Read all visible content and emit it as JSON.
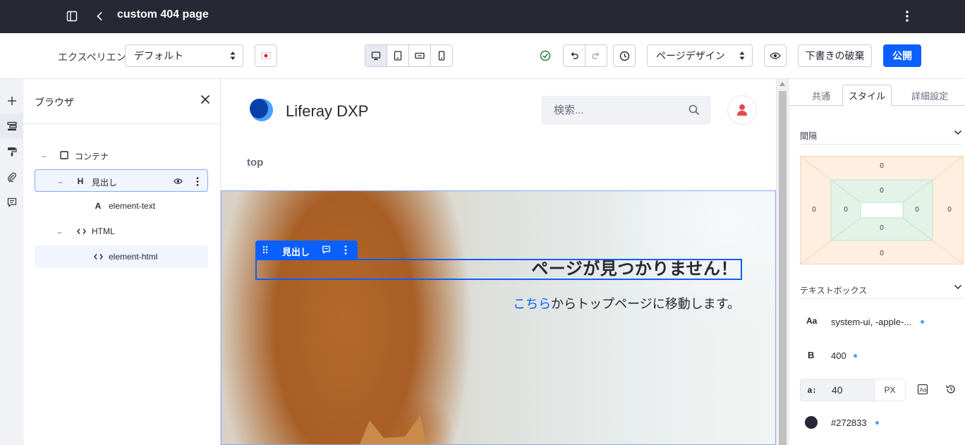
{
  "topbar": {
    "title": "custom 404 page"
  },
  "toolbar": {
    "experience_label": "エクスペリエンス",
    "experience_value": "デフォルト",
    "mode_value": "ページデザイン",
    "discard_label": "下書きの破棄",
    "publish_label": "公開"
  },
  "browser": {
    "title": "ブラウザ",
    "tree": [
      {
        "label": "コンテナ",
        "icon": "H"
      },
      {
        "label": "見出し",
        "icon": "H"
      },
      {
        "label": "element-text",
        "icon": "A"
      },
      {
        "label": "HTML"
      },
      {
        "label": "element-html"
      }
    ]
  },
  "site": {
    "name": "Liferay DXP",
    "search_placeholder": "検索...",
    "nav": "top"
  },
  "fragment": {
    "toolbar_label": "見出し",
    "heading": "ページが見つかりません！",
    "sub_link": "こちら",
    "sub_rest": "からトップページに移動します。"
  },
  "panel": {
    "tabs": [
      "共通",
      "スタイル",
      "詳細設定"
    ],
    "spacing_title": "間隔",
    "spacing_values": {
      "margin_top": "0",
      "margin_left": "0",
      "margin_right": "0",
      "margin_bottom": "0",
      "padding_top": "0",
      "padding_left": "0",
      "padding_right": "0",
      "padding_bottom": "0"
    },
    "textbox_title": "テキストボックス",
    "font_prefix": "Aa",
    "font_family": "system-ui, -apple-...",
    "weight_prefix": "B",
    "font_weight": "400",
    "size_prefix": "a↕",
    "font_size": "40",
    "font_unit": "PX",
    "color_value": "#272833"
  },
  "colors": {
    "topbar": "#272833",
    "primary": "#0b5fff",
    "text": "#272833",
    "success": "#287d3c"
  }
}
